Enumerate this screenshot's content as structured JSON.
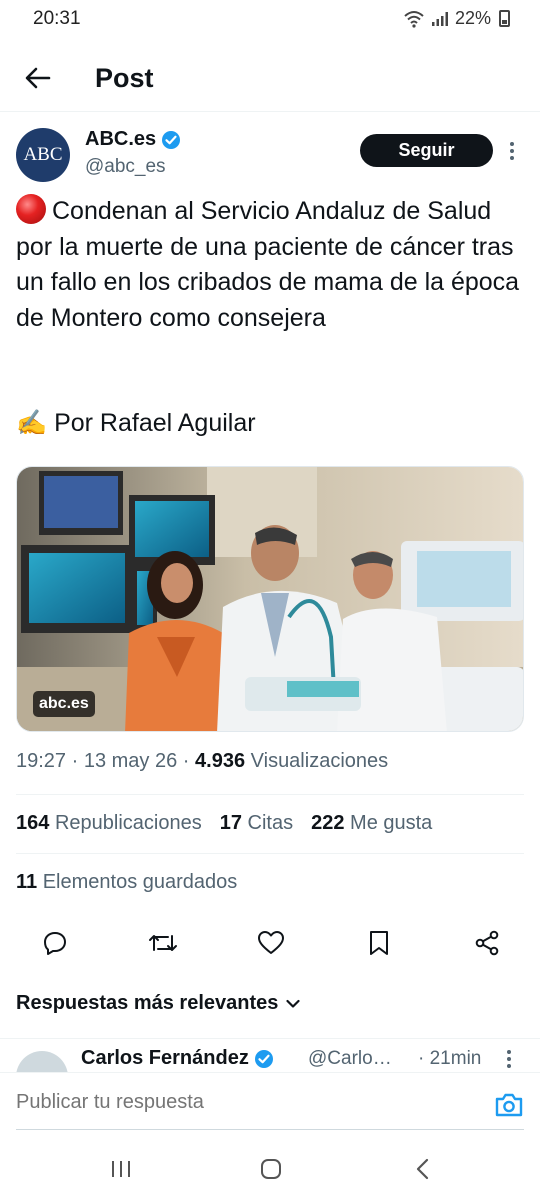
{
  "status_bar": {
    "time": "20:31",
    "battery": "22%"
  },
  "topbar": {
    "title": "Post"
  },
  "author": {
    "avatar_text": "ABC",
    "name": "ABC.es",
    "handle": "@abc_es",
    "follow_label": "Seguir"
  },
  "tweet": {
    "text": "Condenan al Servicio Andaluz de Salud por la muerte de una paciente de cáncer tras un fallo en los cribados de mama de la época de Montero como consejera",
    "byline": "✍️ Por Rafael Aguilar",
    "media_label": "abc.es"
  },
  "meta": {
    "time": "19:27",
    "date": "13 may 26",
    "views": "4.936",
    "views_label": "Visualizaciones"
  },
  "stats": {
    "reposts": "164",
    "reposts_label": "Republicaciones",
    "quotes": "17",
    "quotes_label": "Citas",
    "likes": "222",
    "likes_label": "Me gusta",
    "saved": "11",
    "saved_label": "Elementos guardados"
  },
  "replies": {
    "header": "Respuestas más relevantes"
  },
  "reply_preview": {
    "name": "Carlos Fernández",
    "handle": "@Carlo…",
    "time": "· 21min"
  },
  "compose": {
    "placeholder": "Publicar tu respuesta"
  },
  "colors": {
    "verified": "#1d9bf0",
    "accent": "#1d9bf0",
    "text": "#0f1419",
    "secondary": "#536471"
  }
}
